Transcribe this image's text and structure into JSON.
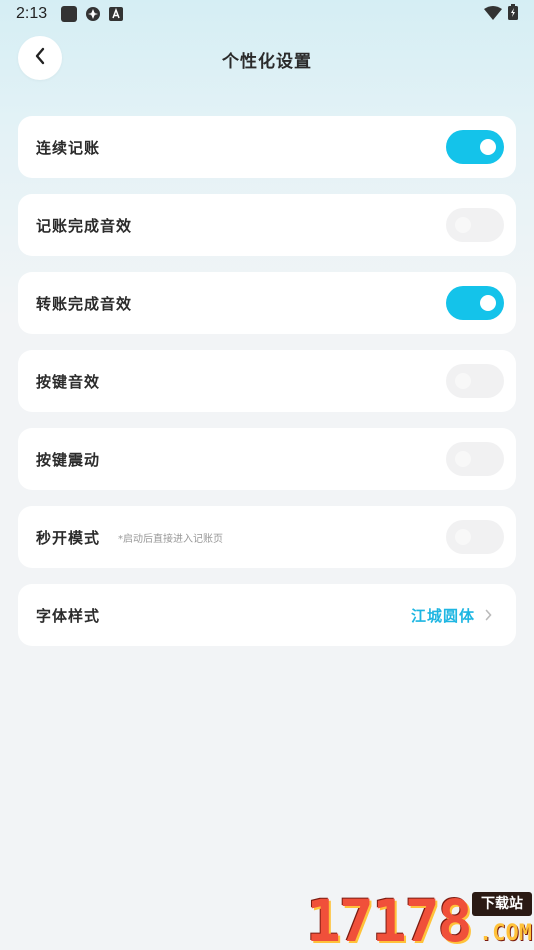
{
  "status_bar": {
    "time": "2:13",
    "icons": [
      "app-square-icon",
      "tool-icon",
      "letter-a-icon"
    ],
    "right_icons": [
      "wifi-icon",
      "battery-icon"
    ]
  },
  "header": {
    "title": "个性化设置",
    "back_icon": "chevron-left-icon"
  },
  "settings": [
    {
      "label": "连续记账",
      "on": true
    },
    {
      "label": "记账完成音效",
      "on": false
    },
    {
      "label": "转账完成音效",
      "on": true
    },
    {
      "label": "按键音效",
      "on": false
    },
    {
      "label": "按键震动",
      "on": false
    },
    {
      "label": "秒开模式",
      "subtext": "*启动后直接进入记账页",
      "on": false
    }
  ],
  "font_style": {
    "label": "字体样式",
    "value": "江城圆体",
    "chevron": "chevron-right-icon"
  },
  "watermark": {
    "digits": "17178",
    "tag": "下载站",
    "suffix": ".COM"
  },
  "colors": {
    "accent": "#14c3ea",
    "value_text": "#1eb6e2",
    "toggle_off": "#f1f1f2",
    "background": "#f2f4f6"
  }
}
